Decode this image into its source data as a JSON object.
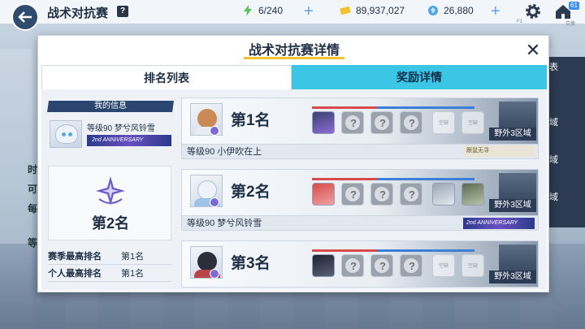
{
  "topbar": {
    "title": "战术对抗赛",
    "help_glyph": "?",
    "stamina": "6/240",
    "credits": "89,937,027",
    "gems": "26,880",
    "mail_count": "61",
    "home_caption": "交换",
    "f1_caption": "F1",
    "colors": {
      "accent": "#3c8ee6",
      "stamina": "#5cc15a",
      "credits": "#f2c230",
      "gems": "#4da3e6"
    }
  },
  "background": {
    "left_labels": [
      "时",
      "可",
      "每",
      "等"
    ],
    "right_tabs": [
      "表",
      "域",
      "域",
      "域"
    ],
    "tab_caption": "Tab"
  },
  "dialog": {
    "title": "战术对抗赛详情",
    "close_glyph": "✕",
    "tabs": [
      {
        "label": "排名列表",
        "active": true
      },
      {
        "label": "奖励详情",
        "active": false
      }
    ],
    "my_info": {
      "header": "我的信息",
      "level_name": "等级90 梦兮风铃雪",
      "banner": "2nd ANNIVERSARY",
      "rank": "第2名",
      "stats": [
        {
          "label": "赛季最高排名",
          "value": "第1名"
        },
        {
          "label": "个人最高排名",
          "value": "第1名"
        }
      ]
    },
    "ranking": [
      {
        "rank": "第1名",
        "player": "等级90 小伊吹在上",
        "region": "野外3区域",
        "tag": "跟鼠无寻",
        "slots": [
          "char",
          "q",
          "q",
          "q",
          "empty",
          "empty"
        ],
        "empty_label": "空缺"
      },
      {
        "rank": "第2名",
        "player": "等级90 梦兮风铃雪",
        "region": "野外3区域",
        "tag": "2nd ANNIVERSARY",
        "slots": [
          "char",
          "q",
          "q",
          "q",
          "char",
          "char"
        ],
        "empty_label": "空缺"
      },
      {
        "rank": "第3名",
        "player": "",
        "region": "野外3区域",
        "tag": "",
        "slots": [
          "char",
          "q",
          "q",
          "q",
          "empty",
          "empty"
        ],
        "empty_label": "空缺"
      }
    ]
  }
}
